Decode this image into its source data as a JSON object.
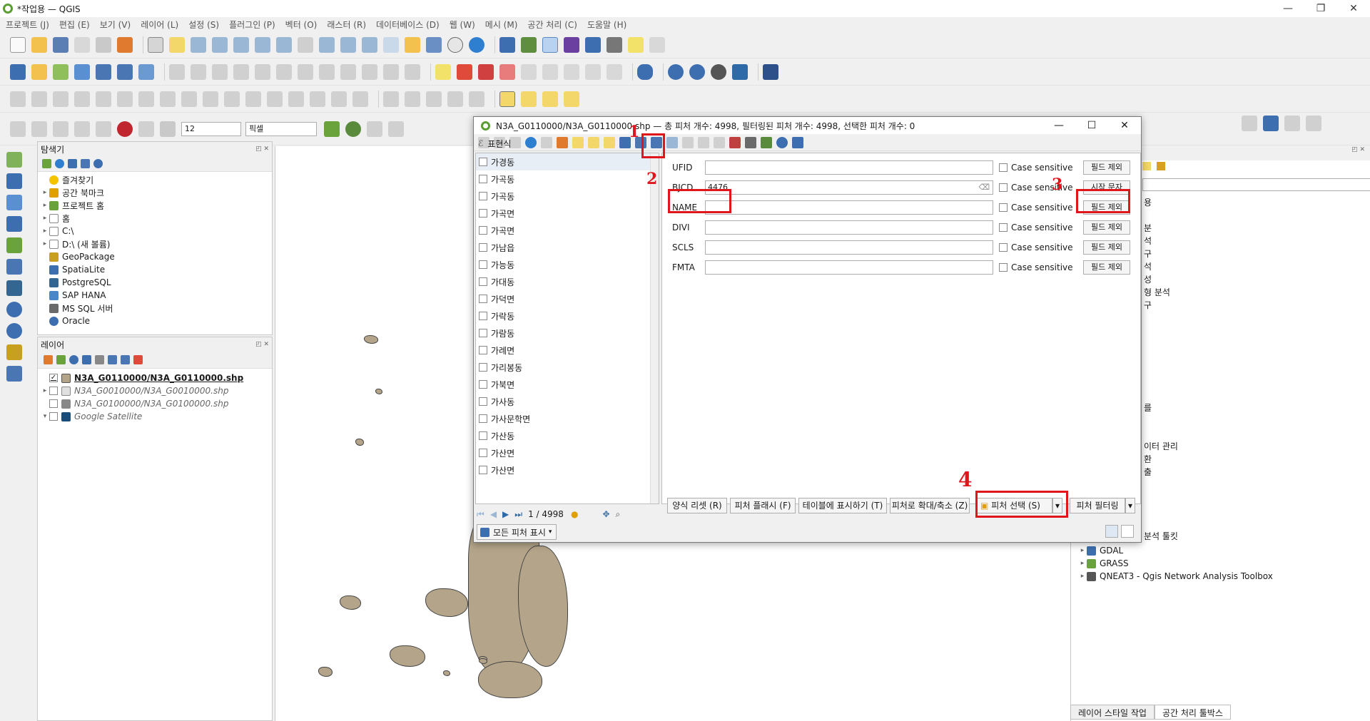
{
  "app": {
    "title": "*작업용 — QGIS"
  },
  "menus": [
    "프로젝트 (J)",
    "편집 (E)",
    "보기 (V)",
    "레이어 (L)",
    "설정 (S)",
    "플러그인 (P)",
    "벡터 (O)",
    "래스터 (R)",
    "데이터베이스 (D)",
    "웹 (W)",
    "메시 (M)",
    "공간 처리 (C)",
    "도움말 (H)"
  ],
  "snap": {
    "value": "12",
    "unit": "픽셀"
  },
  "browser": {
    "title": "탐색기",
    "items": [
      {
        "label": "즐겨찾기",
        "chev": "",
        "color": "#f5c400"
      },
      {
        "label": "공간 북마크",
        "chev": "▸",
        "color": "#e0a000"
      },
      {
        "label": "프로젝트 홈",
        "chev": "▸",
        "color": "#6aa23c"
      },
      {
        "label": "홈",
        "chev": "▸",
        "color": "#888"
      },
      {
        "label": "C:\\",
        "chev": "▸",
        "color": "#ddd"
      },
      {
        "label": "D:\\ (새 볼륨)",
        "chev": "▸",
        "color": "#ddd"
      },
      {
        "label": "GeoPackage",
        "chev": "",
        "color": "#c8a020"
      },
      {
        "label": "SpatiaLite",
        "chev": "",
        "color": "#3d6fb0"
      },
      {
        "label": "PostgreSQL",
        "chev": "",
        "color": "#336791"
      },
      {
        "label": "SAP HANA",
        "chev": "",
        "color": "#4a86c8"
      },
      {
        "label": "MS SQL 서버",
        "chev": "",
        "color": "#6a6a6a"
      },
      {
        "label": "Oracle",
        "chev": "",
        "color": "#3d6fb0"
      }
    ]
  },
  "layers": {
    "title": "레이어",
    "items": [
      {
        "label": "N3A_G0110000/N3A_G0110000.shp",
        "checked": "✓",
        "chev": "",
        "color": "#b4a58a"
      },
      {
        "label": "N3A_G0010000/N3A_G0010000.shp",
        "checked": "",
        "chev": "▸",
        "color": "#e0e0e0"
      },
      {
        "label": "N3A_G0100000/N3A_G0100000.shp",
        "checked": "",
        "chev": "",
        "color": "#888"
      },
      {
        "label": "Google Satellite",
        "checked": "",
        "chev": "▾",
        "color": "#1a4c7a"
      }
    ]
  },
  "dialog": {
    "title": "N3A_G0110000/N3A_G0110000.shp — 총 피처 개수: 4998, 필터링된 피처 개수: 4998, 선택한 피처 개수: 0",
    "expression_label": "표현식",
    "features": [
      "가경동",
      "가곡동",
      "가곡동",
      "가곡면",
      "가곡면",
      "가남읍",
      "가능동",
      "가대동",
      "가덕면",
      "가락동",
      "가람동",
      "가례면",
      "가리봉동",
      "가북면",
      "가사동",
      "가사문학면",
      "가산동",
      "가산면",
      "가산면"
    ],
    "page": "1 / 4998",
    "show_all": "모든 피처 표시",
    "fields": [
      {
        "name": "UFID",
        "value": "",
        "case": "Case sensitive",
        "btn": "필드 제외"
      },
      {
        "name": "BJCD",
        "value": "4476",
        "case": "Case sensitive",
        "btn": "시작 문자"
      },
      {
        "name": "NAME",
        "value": "",
        "case": "Case sensitive",
        "btn": "필드 제외"
      },
      {
        "name": "DIVI",
        "value": "",
        "case": "Case sensitive",
        "btn": "필드 제외"
      },
      {
        "name": "SCLS",
        "value": "",
        "case": "Case sensitive",
        "btn": "필드 제외"
      },
      {
        "name": "FMTA",
        "value": "",
        "case": "Case sensitive",
        "btn": "필드 제외"
      }
    ],
    "buttons": {
      "reset": "양식 리셋 (R)",
      "flash": "피처 플래시 (F)",
      "show_table": "테이블에 표시하기 (T)",
      "zoom": "피처로 확대/축소 (Z)",
      "select": "피처 선택 (S)",
      "filter": "피처 필터링"
    }
  },
  "annotations": [
    "1",
    "2",
    "3",
    "4"
  ],
  "toolbox": {
    "items": [
      "GDAL",
      "GRASS",
      "QNEAT3 - Qgis Network Analysis Toolbox"
    ],
    "tabs": [
      "레이어 스타일 작업",
      "공간 처리 툴박스"
    ],
    "partial": [
      "용",
      "분석",
      "구",
      "석",
      "성",
      "형 분석",
      "구",
      "를",
      "이터 관리",
      "환",
      "출",
      "분석 툴킷"
    ]
  },
  "colors": {
    "accent": "#e0161d",
    "polygon": "#b4a58a"
  }
}
